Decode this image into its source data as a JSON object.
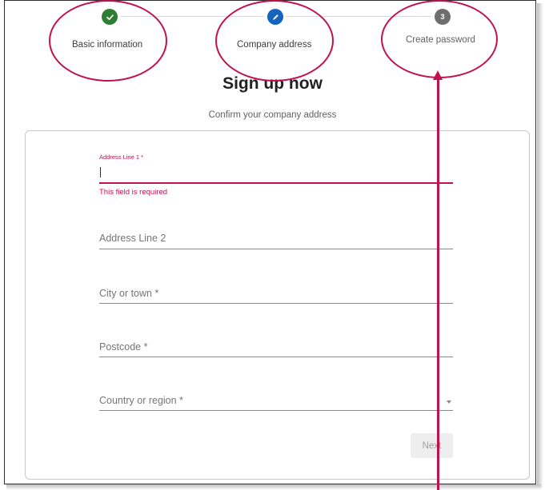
{
  "stepper": {
    "steps": [
      {
        "label": "Basic information",
        "state": "completed",
        "icon": "check-icon"
      },
      {
        "label": "Company address",
        "state": "active",
        "icon": "pencil-icon"
      },
      {
        "label": "Create password",
        "state": "pending",
        "number": "3"
      }
    ]
  },
  "page": {
    "title": "Sign up now",
    "subtitle": "Confirm your company address"
  },
  "form": {
    "address_line_1": {
      "floating_label": "Address Line 1 *",
      "value": "",
      "error": "This field is required"
    },
    "address_line_2": {
      "placeholder": "Address Line 2"
    },
    "city": {
      "placeholder": "City or town *"
    },
    "postcode": {
      "placeholder": "Postcode *"
    },
    "country": {
      "placeholder": "Country or region *",
      "icon": "dropdown-arrow-icon"
    },
    "next_label": "Next"
  },
  "colors": {
    "completed": "#2e7d32",
    "active": "#1565c0",
    "pending": "#6e6e6e",
    "error": "#c0124d",
    "annotation": "#c0124d"
  }
}
